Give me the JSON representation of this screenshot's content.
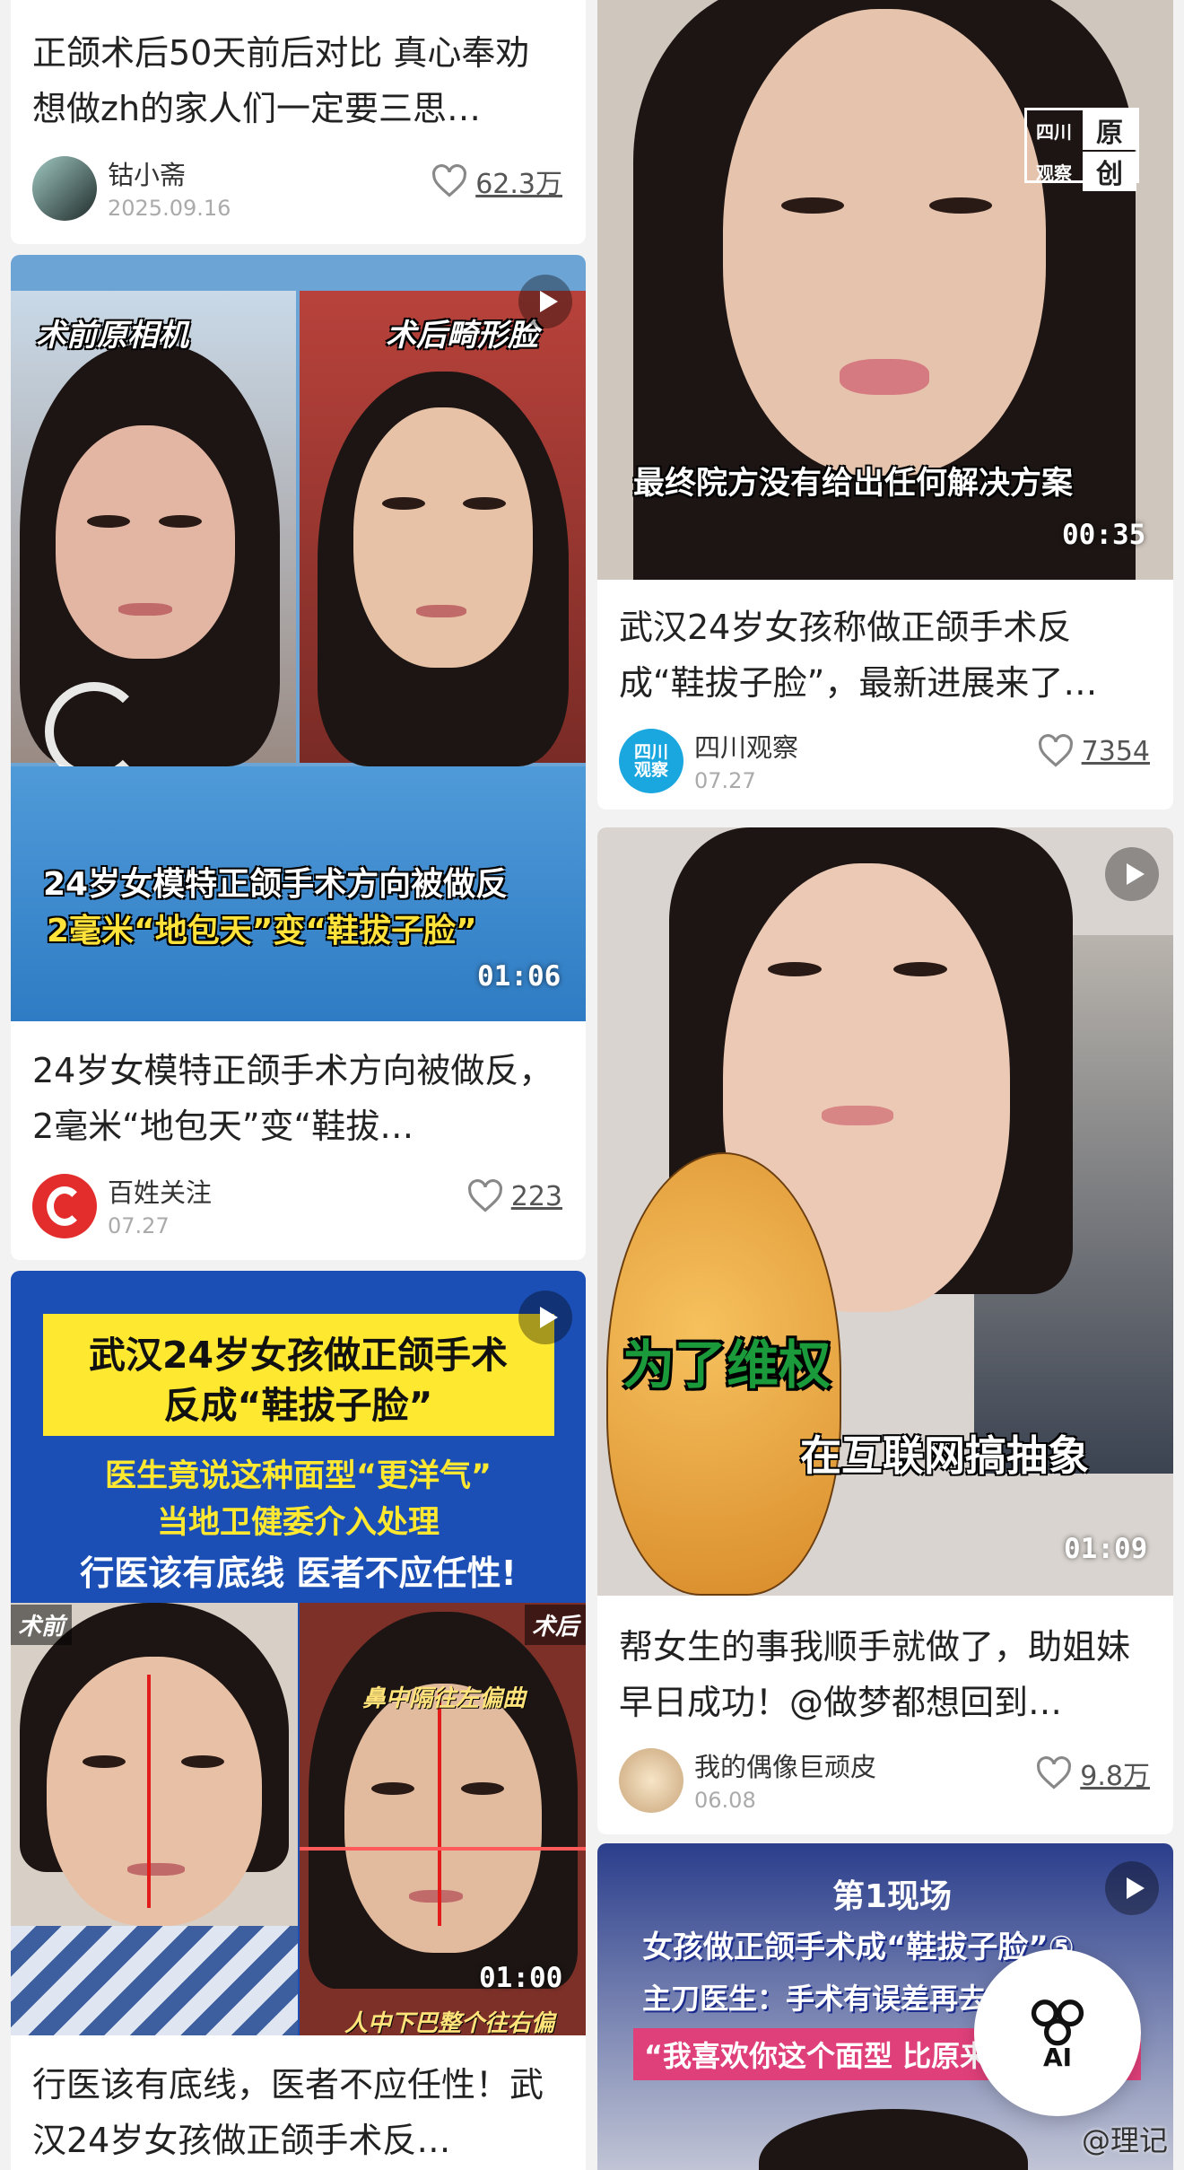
{
  "cards": [
    {
      "title": "正颌术后50天前后对比 真心奉劝想做zh的家人们一定要三思…",
      "author": "钴小斋",
      "date": "2025.09.16",
      "likes": "62.3万"
    },
    {
      "title": "武汉24岁女孩称做正颌手术反成“鞋拔子脸”，最新进展来了…",
      "author": "四川观察",
      "date": "07.27",
      "likes": "7354",
      "cover_subtitle": "最终院方没有给出任何解决方案",
      "duration": "00:35",
      "badge": [
        "四川",
        "原",
        "观察",
        "创"
      ],
      "avatar_text": [
        "四川",
        "观察"
      ]
    },
    {
      "title": "24岁女模特正颌手术方向被做反，2毫米“地包天”变“鞋拔…",
      "author": "百姓关注",
      "date": "07.27",
      "likes": "223",
      "cover_left_label": "术前原相机",
      "cover_right_label": "术后畸形脸",
      "caption_line1": "24岁女模特正颌手术方向被做反",
      "caption_line2": "2毫米“地包天”变“鞋拔子脸”",
      "duration": "01:06"
    },
    {
      "title": "帮女生的事我顺手就做了，助姐妹早日成功！@做梦都想回到…",
      "author": "我的偶像巨顽皮",
      "date": "06.08",
      "likes": "9.8万",
      "sticker1": "为了维权",
      "sticker2": "在互联网搞抽象",
      "duration": "01:09"
    },
    {
      "title": "行医该有底线，医者不应任性！武汉24岁女孩做正颌手术反…",
      "headline1": "武汉24岁女孩做正颌手术",
      "headline2": "反成“鞋拔子脸”",
      "headline3": "医生竟说这种面型“更洋气”",
      "headline4": "当地卫健委介入处理",
      "headline5": "行医该有底线 医者不应任性!",
      "before_label": "术前",
      "after_label": "术后",
      "note_top": "鼻中隔往左偏曲",
      "note_bottom": "人中下巴整个往右偏",
      "duration": "01:00"
    },
    {
      "brand": "第1现场",
      "line1": "女孩做正颌手术成“鞋拔子脸”⑤",
      "line2": "主刀医生：手术有误差再去",
      "line3": "“我喜欢你这个面型 比原来"
    }
  ],
  "ai_button": "AI",
  "watermark": "@理记"
}
